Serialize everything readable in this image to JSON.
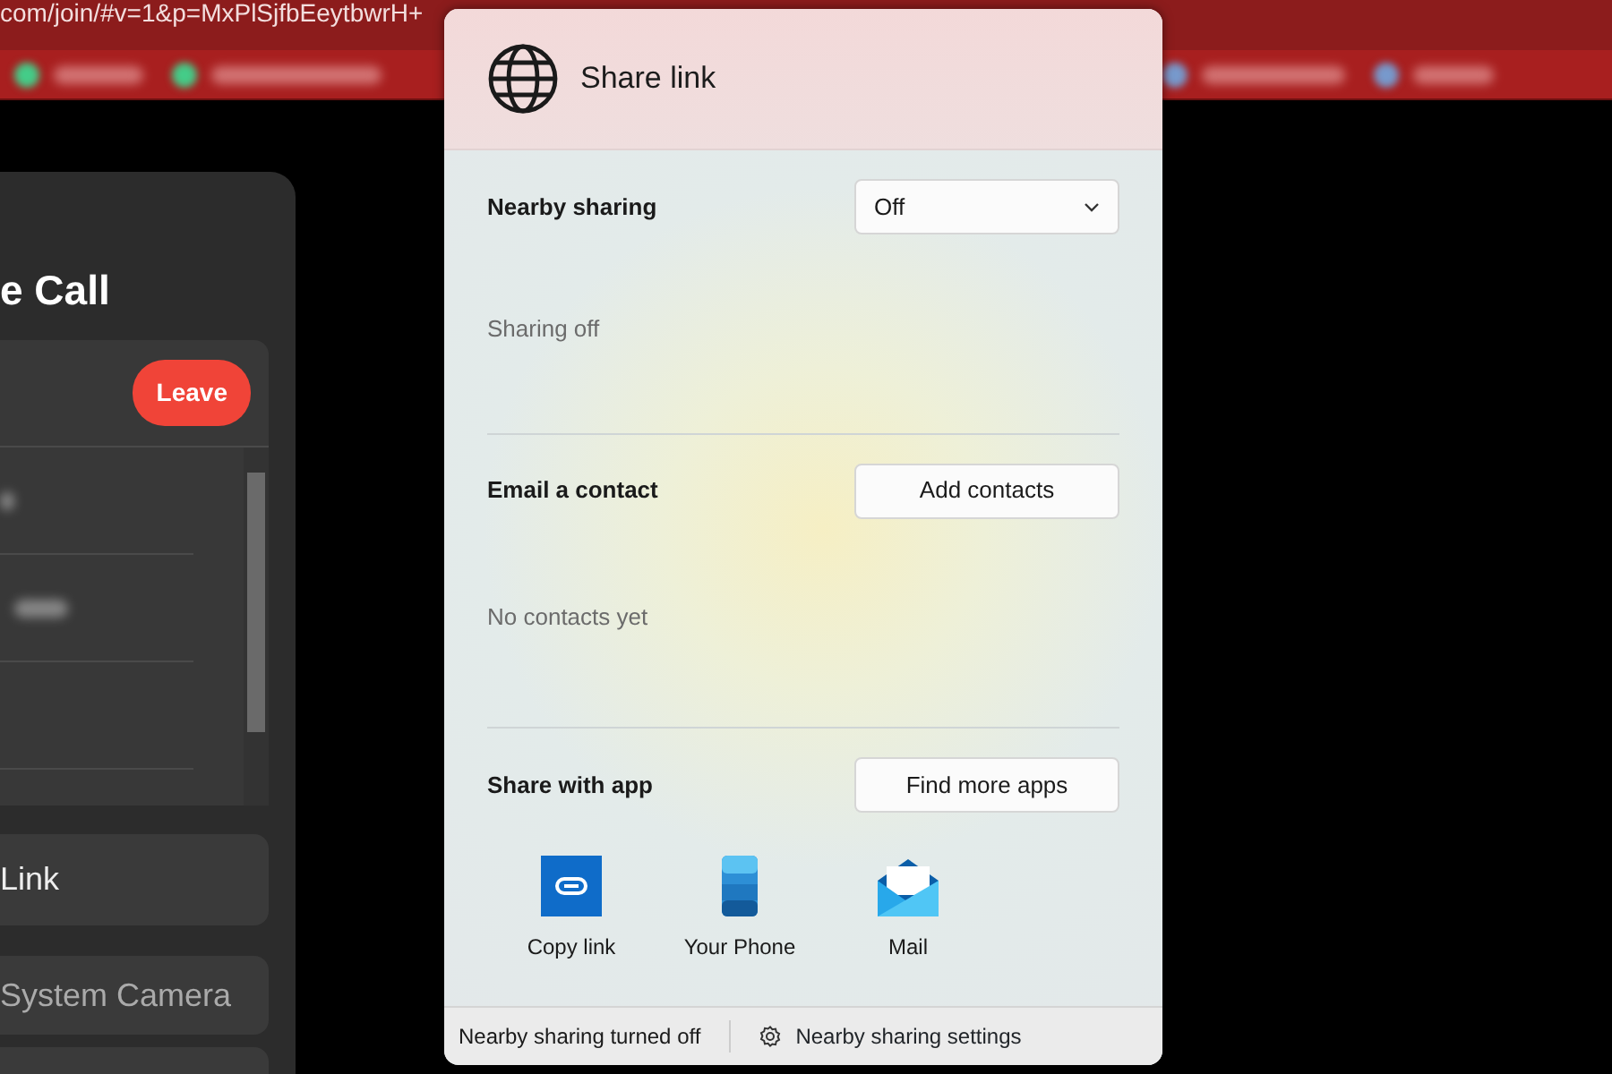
{
  "browser": {
    "url": "com/join/#v=1&p=MxPlSjfbEeytbwrH+"
  },
  "call_panel": {
    "title": "e Call",
    "leave_button": "Leave",
    "link_card": "Link",
    "camera_card": "System Camera"
  },
  "share_dialog": {
    "title": "Share link",
    "nearby_sharing": {
      "label": "Nearby sharing",
      "value": "Off",
      "status": "Sharing off"
    },
    "email": {
      "label": "Email a contact",
      "button": "Add contacts",
      "status": "No contacts yet"
    },
    "apps": {
      "label": "Share with app",
      "button": "Find more apps",
      "items": [
        {
          "kind": "link",
          "label": "Copy link"
        },
        {
          "kind": "phone",
          "label": "Your Phone"
        },
        {
          "kind": "mail",
          "label": "Mail"
        }
      ]
    },
    "footer": {
      "status": "Nearby sharing turned off",
      "settings_link": "Nearby sharing settings"
    }
  }
}
